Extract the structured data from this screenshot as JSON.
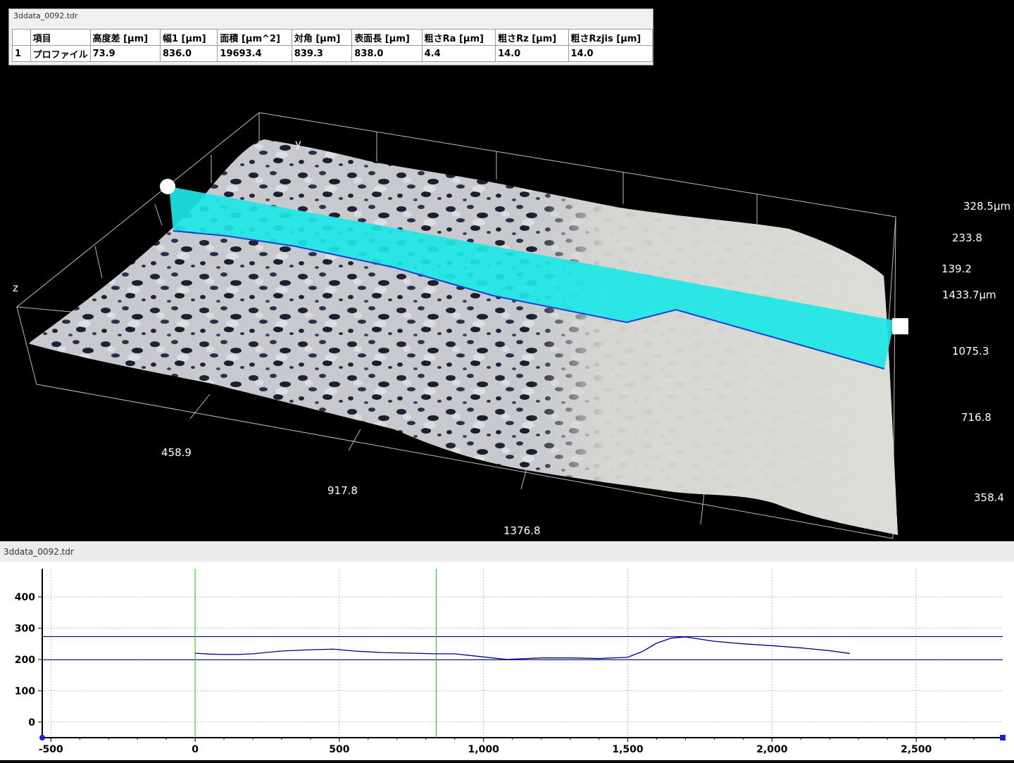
{
  "results_panel": {
    "title": "3ddata_0092.tdr",
    "columns": [
      "",
      "項目",
      "高度差 [μm]",
      "幅1 [μm]",
      "面積 [μm^2]",
      "対角 [μm]",
      "表面長 [μm]",
      "粗さRa [μm]",
      "粗さRz [μm]",
      "粗さRzjis [μm]"
    ],
    "rows": [
      [
        "1",
        "プロファイル",
        "73.9",
        "836.0",
        "19693.4",
        "839.3",
        "838.0",
        "4.4",
        "14.0",
        "14.0"
      ]
    ]
  },
  "view3d": {
    "axis_y": "y",
    "axis_z": "z",
    "z_labels": [
      "328.5μm",
      "233.8",
      "139.2"
    ],
    "y_labels": [
      "1433.7μm",
      "1075.3",
      "716.8",
      "358.4"
    ],
    "x_labels": [
      "458.9",
      "917.8",
      "1376.8"
    ],
    "profile_color": "#1de6e6"
  },
  "graph_panel": {
    "title": "3ddata_0092.tdr",
    "chart_data": {
      "type": "line",
      "x_ticks": [
        "-500",
        "0",
        "500",
        "1,000",
        "1,500",
        "2,000",
        "2,500"
      ],
      "y_ticks": [
        "0",
        "100",
        "200",
        "300",
        "400"
      ],
      "xlim": [
        -530,
        2800
      ],
      "ylim": [
        -50,
        490
      ],
      "grid": true,
      "series": [
        {
          "color": "#000080",
          "x": [
            0,
            50,
            100,
            150,
            200,
            300,
            400,
            480,
            550,
            650,
            750,
            830,
            900,
            980,
            1080,
            1200,
            1300,
            1400,
            1500,
            1550,
            1600,
            1650,
            1700,
            1750,
            1800,
            1900,
            2000,
            2100,
            2200,
            2270
          ],
          "y": [
            220,
            217,
            216,
            216,
            218,
            227,
            231,
            233,
            227,
            222,
            220,
            218,
            218,
            210,
            200,
            205,
            205,
            203,
            207,
            225,
            252,
            268,
            272,
            265,
            258,
            250,
            244,
            237,
            228,
            219
          ]
        }
      ],
      "hlines": [
        {
          "y": 273,
          "color": "#00008b"
        },
        {
          "y": 199,
          "color": "#00008b"
        }
      ],
      "vlines": [
        {
          "x": 0,
          "color": "#33cc33"
        },
        {
          "x": 836,
          "color": "#33cc33"
        }
      ]
    }
  }
}
